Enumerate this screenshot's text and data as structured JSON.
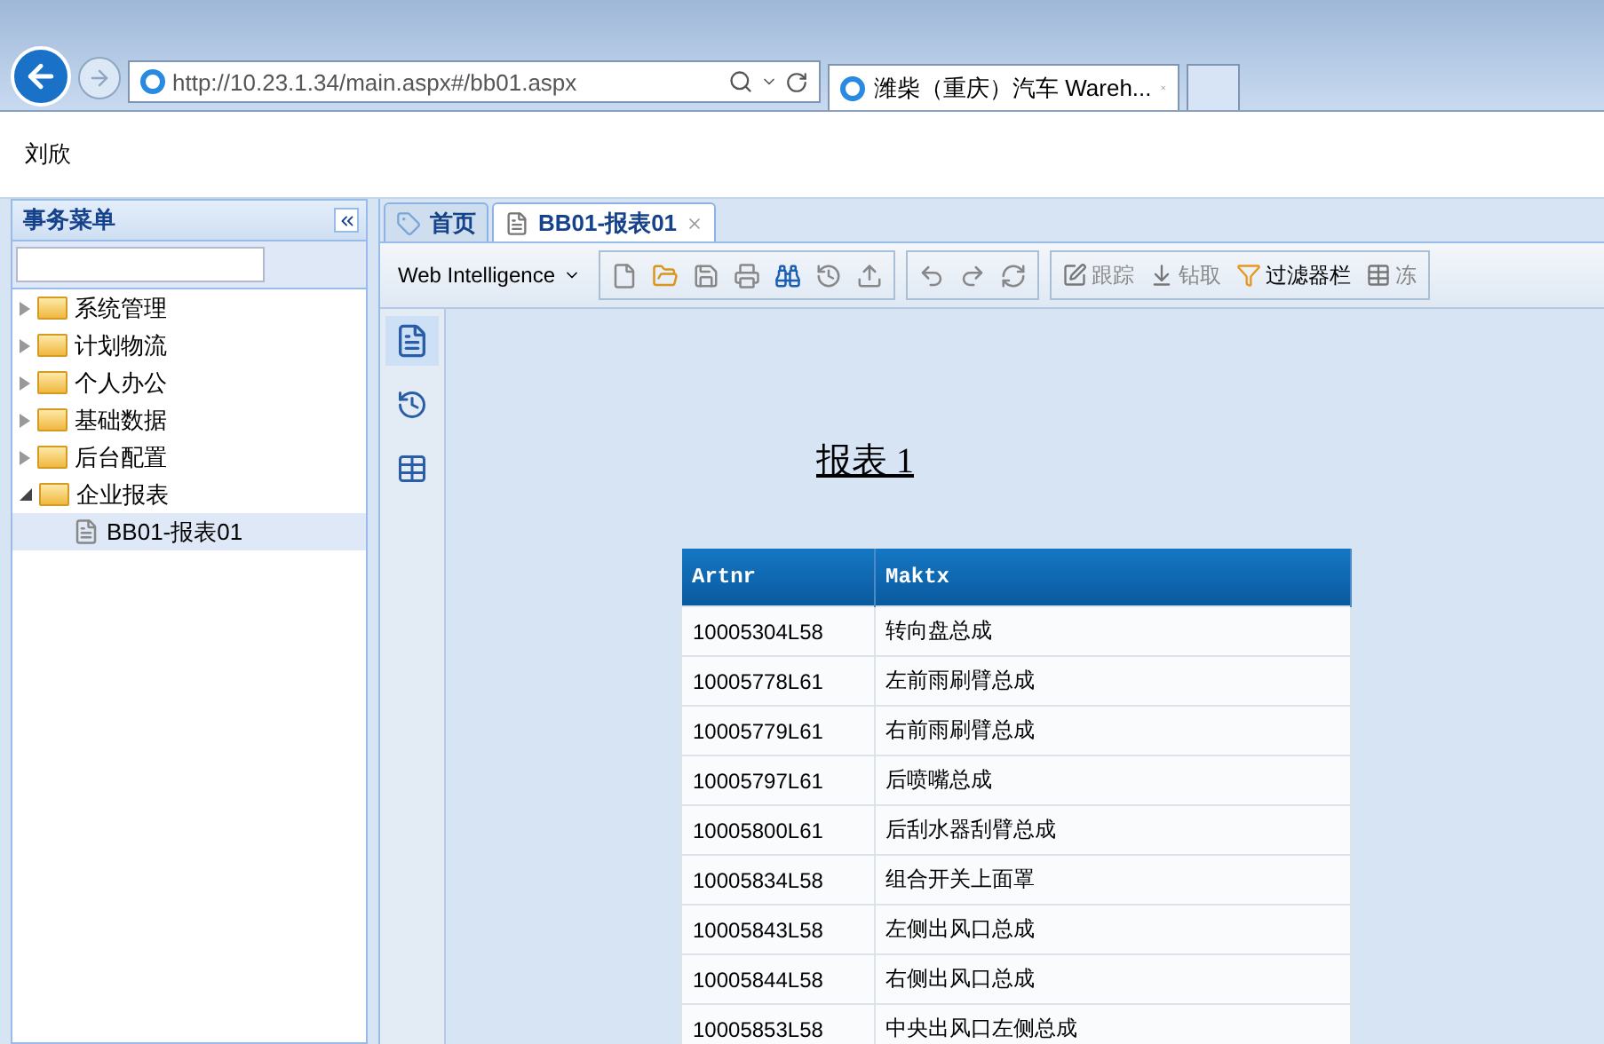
{
  "browser": {
    "address": "http://10.23.1.34/main.aspx#/bb01.aspx",
    "tabs": [
      {
        "title": "潍柴（重庆）汽车 Wareh...",
        "selected": true
      }
    ]
  },
  "header": {
    "user": "刘欣"
  },
  "sidebar": {
    "title": "事务菜单",
    "items": [
      {
        "kind": "folder",
        "label": "系统管理",
        "expanded": false,
        "selected": false
      },
      {
        "kind": "folder",
        "label": "计划物流",
        "expanded": false,
        "selected": false
      },
      {
        "kind": "folder",
        "label": "个人办公",
        "expanded": false,
        "selected": false
      },
      {
        "kind": "folder",
        "label": "基础数据",
        "expanded": false,
        "selected": false
      },
      {
        "kind": "folder",
        "label": "后台配置",
        "expanded": false,
        "selected": false
      },
      {
        "kind": "folder",
        "label": "企业报表",
        "expanded": true,
        "selected": false,
        "children": [
          {
            "kind": "document",
            "label": "BB01-报表01",
            "selected": true
          }
        ]
      }
    ]
  },
  "tabs": [
    {
      "label": "首页",
      "selected": false,
      "closable": false
    },
    {
      "label": "BB01-报表01",
      "selected": true,
      "closable": true
    }
  ],
  "toolbar": {
    "mode": "Web Intelligence",
    "items": [
      {
        "label": "跟踪",
        "disabled": true
      },
      {
        "label": "钻取",
        "disabled": true
      },
      {
        "label": "过滤器栏",
        "disabled": false
      },
      {
        "label": "冻",
        "disabled": true
      }
    ]
  },
  "report": {
    "title": "报表 1",
    "columns": [
      "Artnr",
      "Maktx"
    ],
    "rows": [
      [
        "10005304L58",
        "转向盘总成"
      ],
      [
        "10005778L61",
        "左前雨刷臂总成"
      ],
      [
        "10005779L61",
        "右前雨刷臂总成"
      ],
      [
        "10005797L61",
        "后喷嘴总成"
      ],
      [
        "10005800L61",
        "后刮水器刮臂总成"
      ],
      [
        "10005834L58",
        "组合开关上面罩"
      ],
      [
        "10005843L58",
        "左侧出风口总成"
      ],
      [
        "10005844L58",
        "右侧出风口总成"
      ],
      [
        "10005853L58",
        "中央出风口左侧总成"
      ]
    ]
  }
}
